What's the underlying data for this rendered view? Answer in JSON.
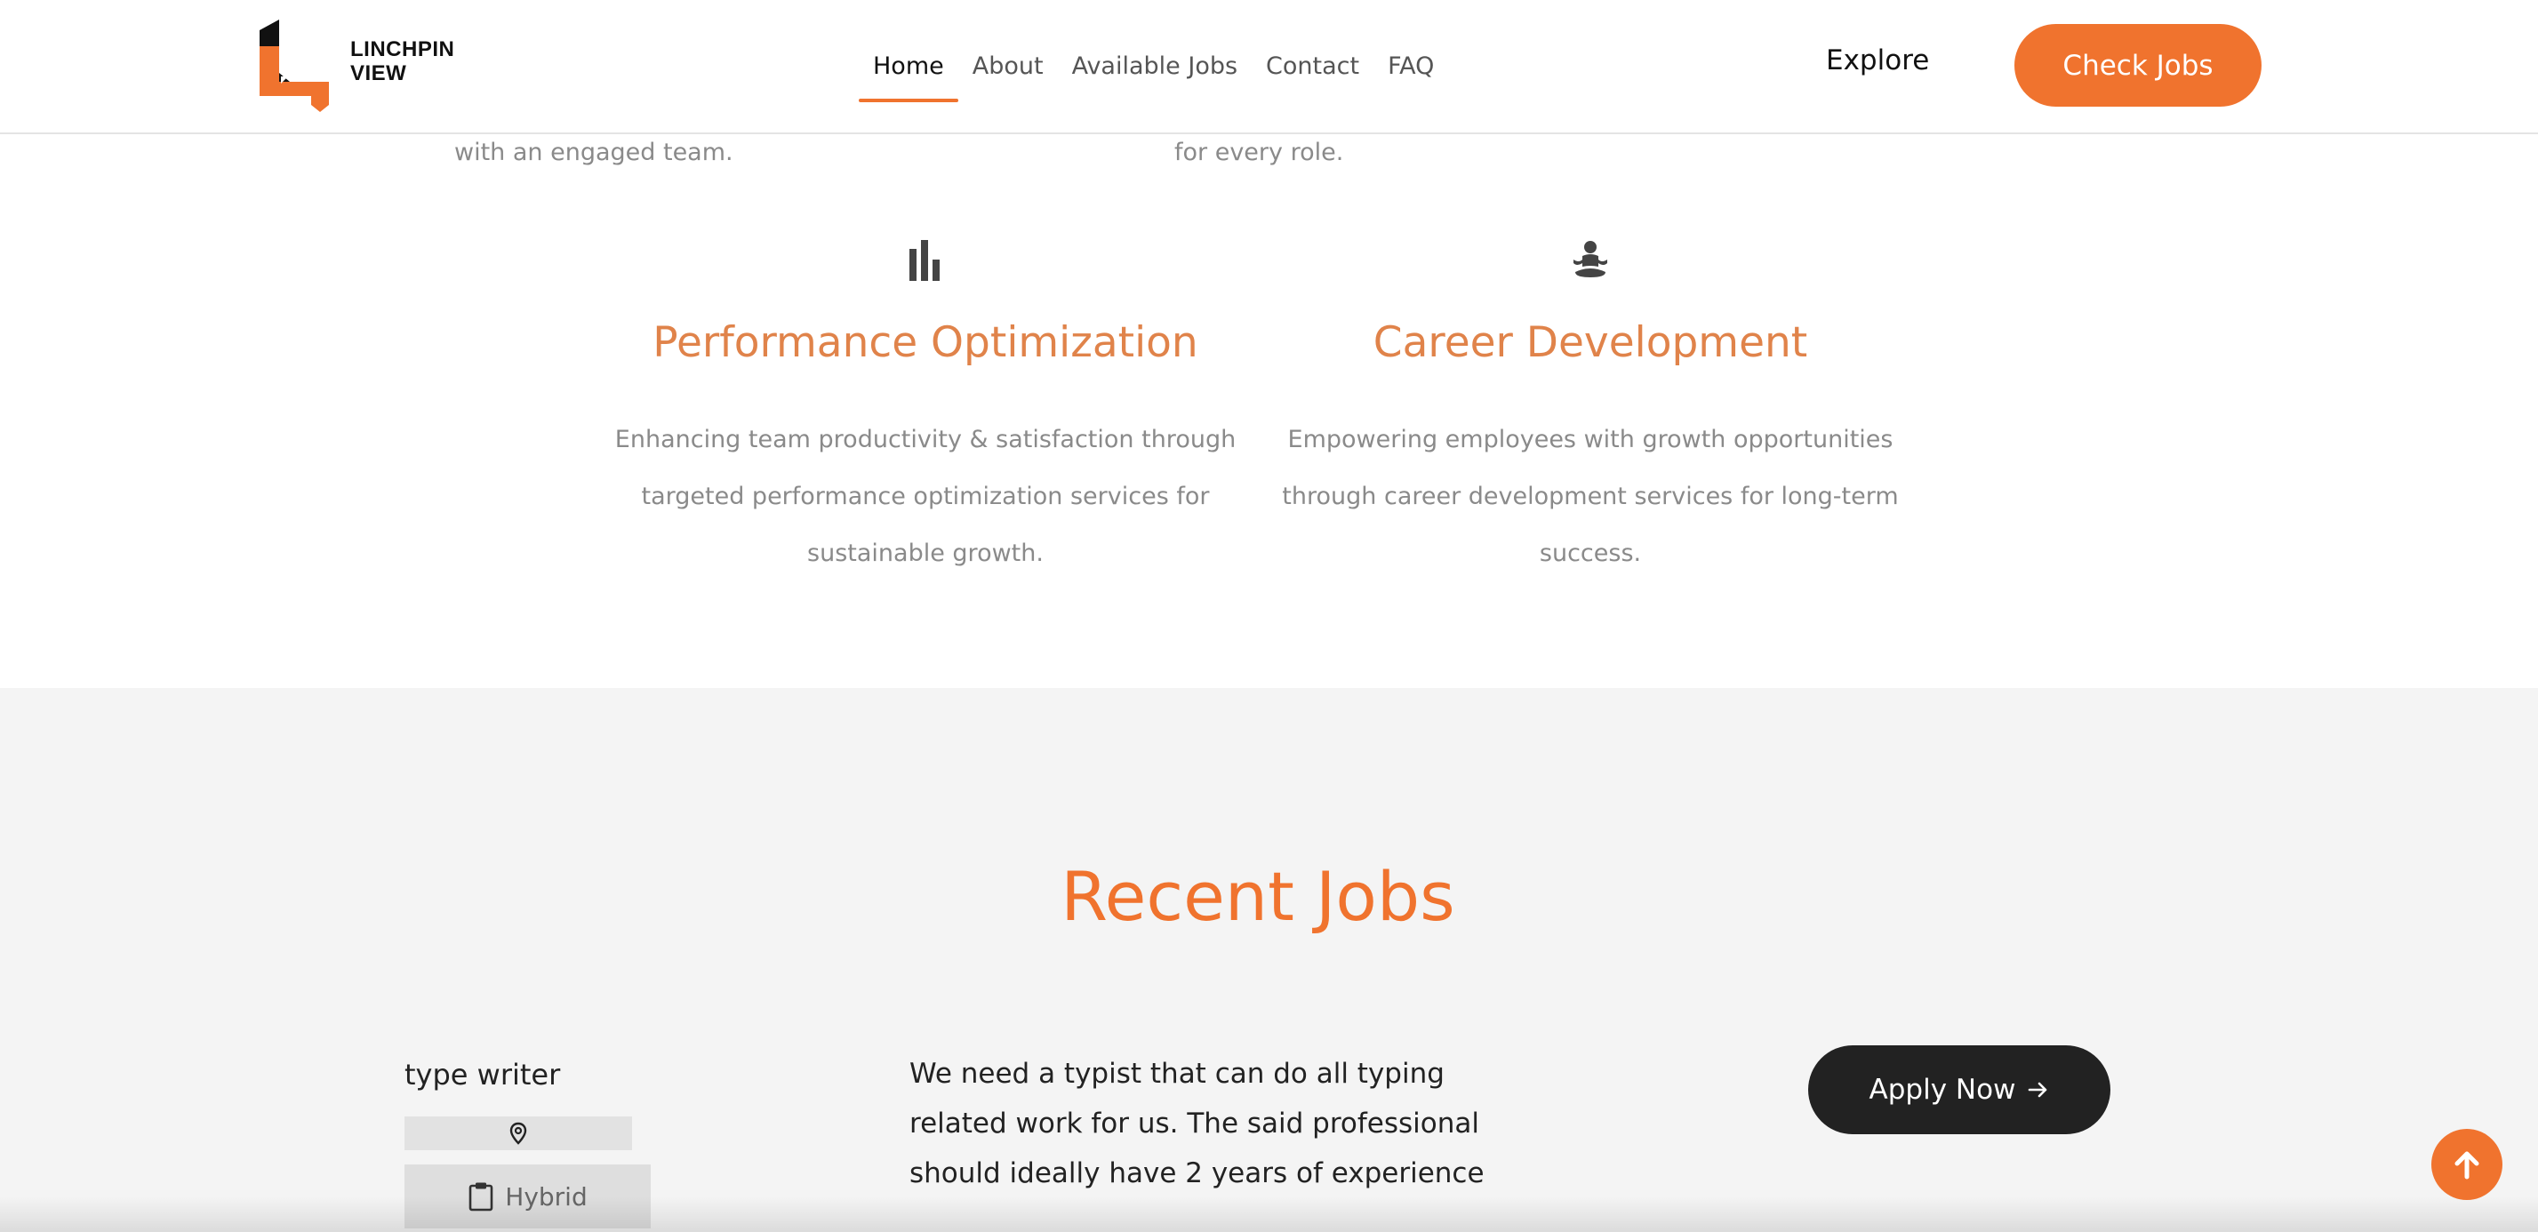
{
  "brand": {
    "line1": "LINCHPIN",
    "line2": "VIEW",
    "accent_color": "#f0732e"
  },
  "nav": {
    "items": [
      {
        "label": "Home",
        "active": true
      },
      {
        "label": "About",
        "active": false
      },
      {
        "label": "Available Jobs",
        "active": false
      },
      {
        "label": "Contact",
        "active": false
      },
      {
        "label": "FAQ",
        "active": false
      }
    ],
    "explore_label": "Explore",
    "cta_label": "Check Jobs"
  },
  "features_partial": {
    "left_tail": "with an engaged team.",
    "right_tail": "for every role."
  },
  "features": [
    {
      "icon": "bar-chart-icon",
      "title": "Performance Optimization",
      "description": "Enhancing team productivity & satisfaction through targeted performance optimization services for sustainable growth."
    },
    {
      "icon": "meditation-icon",
      "title": "Career Development",
      "description": "Empowering employees with growth opportunities through career development services for long-term success."
    }
  ],
  "recent_jobs": {
    "title": "Recent Jobs",
    "jobs": [
      {
        "name": "type writer",
        "location": "",
        "work_type": "Hybrid",
        "description": "We need a typist that can do all typing related work for us. The said professional should ideally have 2 years of experience",
        "apply_label": "Apply Now"
      }
    ]
  },
  "colors": {
    "accent": "#f0732e",
    "feature_title": "#e0834a",
    "section_bg": "#f4f4f4",
    "dark_button": "#222222"
  }
}
